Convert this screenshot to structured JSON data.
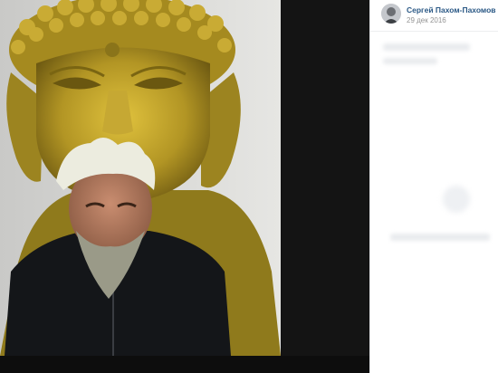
{
  "post": {
    "author_name": "Сергей Пахом-Пахомов",
    "date": "29 дек 2016"
  },
  "photo": {
    "subject": "buddha-statue-portrait"
  },
  "colors": {
    "link": "#2a5885",
    "muted": "#939393",
    "viewer_bg": "#141414",
    "gold": "#b39a2a"
  }
}
